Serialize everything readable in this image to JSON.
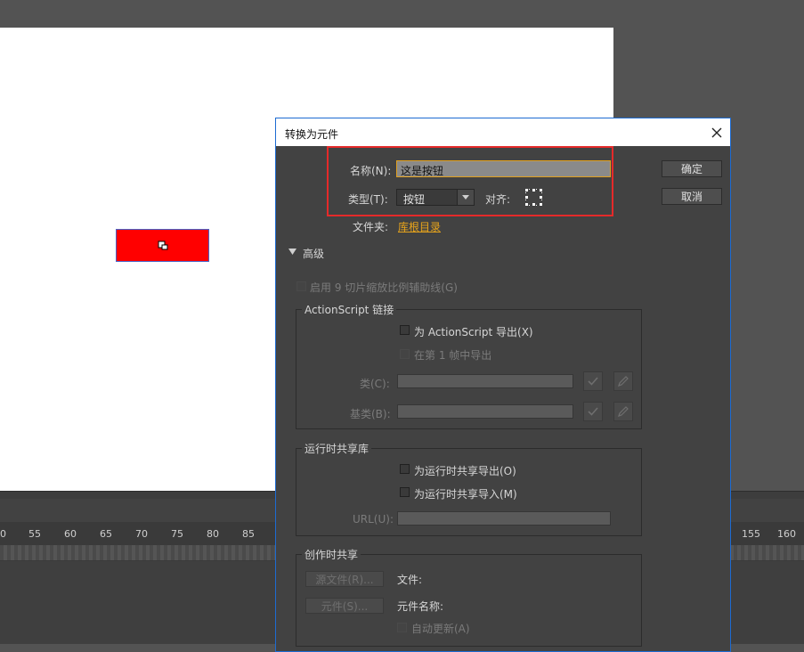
{
  "dialog": {
    "title": "转换为元件",
    "name_label": "名称(N):",
    "name_value": "这是按钮",
    "type_label": "类型(T):",
    "type_value": "按钮",
    "align_label": "对齐:",
    "folder_label": "文件夹:",
    "folder_link": "库根目录",
    "ok_label": "确定",
    "cancel_label": "取消",
    "advanced_label": "高级",
    "enable_9slice_label": "启用 9 切片缩放比例辅助线(G)",
    "actionscript": {
      "title": "ActionScript 链接",
      "export_for_as": "为 ActionScript 导出(X)",
      "export_frame1": "在第 1 帧中导出",
      "class_label": "类(C):",
      "base_class_label": "基类(B):"
    },
    "runtime_share": {
      "title": "运行时共享库",
      "export_runtime": "为运行时共享导出(O)",
      "import_runtime": "为运行时共享导入(M)",
      "url_label": "URL(U):"
    },
    "authortime_share": {
      "title": "创作时共享",
      "source_file_button": "源文件(R)...",
      "symbol_button": "元件(S)...",
      "file_label": "文件:",
      "symbol_name_label": "元件名称:",
      "auto_update_label": "自动更新(A)"
    }
  },
  "timeline": {
    "ticks_left": [
      "0",
      "55",
      "60",
      "65",
      "70",
      "75",
      "80",
      "85"
    ],
    "ticks_right": [
      "155",
      "160"
    ]
  },
  "colors": {
    "highlight": "#e52a2a",
    "folder_link": "#e8a41b",
    "stage_rect": "#ff0000",
    "dialog_border": "#1d6bd2"
  }
}
